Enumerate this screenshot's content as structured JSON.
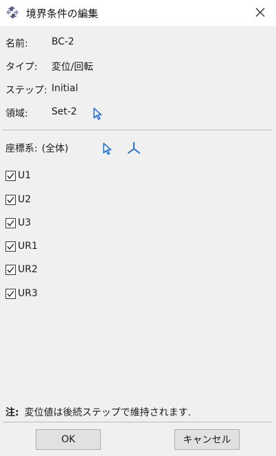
{
  "window": {
    "title": "境界条件の編集",
    "close_icon": "close-icon",
    "app_icon": "abaqus-icon"
  },
  "fields": {
    "name_label": "名前:",
    "name_value": "BC-2",
    "type_label": "タイプ:",
    "type_value": "変位/回転",
    "step_label": "ステップ:",
    "step_value": "Initial",
    "region_label": "領域:",
    "region_value": "Set-2",
    "region_pick_icon": "cursor-arrow-icon"
  },
  "csys": {
    "label": "座標系:",
    "value": "(全体)",
    "pick_icon": "cursor-arrow-icon",
    "axis_icon": "csys-axes-icon"
  },
  "dofs": [
    {
      "label": "U1",
      "checked": true
    },
    {
      "label": "U2",
      "checked": true
    },
    {
      "label": "U3",
      "checked": true
    },
    {
      "label": "UR1",
      "checked": true
    },
    {
      "label": "UR2",
      "checked": true
    },
    {
      "label": "UR3",
      "checked": true
    }
  ],
  "note": {
    "prefix": "注:",
    "text": "変位値は後続ステップで維持されます."
  },
  "buttons": {
    "ok": "OK",
    "cancel": "キャンセル"
  },
  "colors": {
    "accent": "#1f6fd6",
    "background": "#f0f0f0"
  }
}
